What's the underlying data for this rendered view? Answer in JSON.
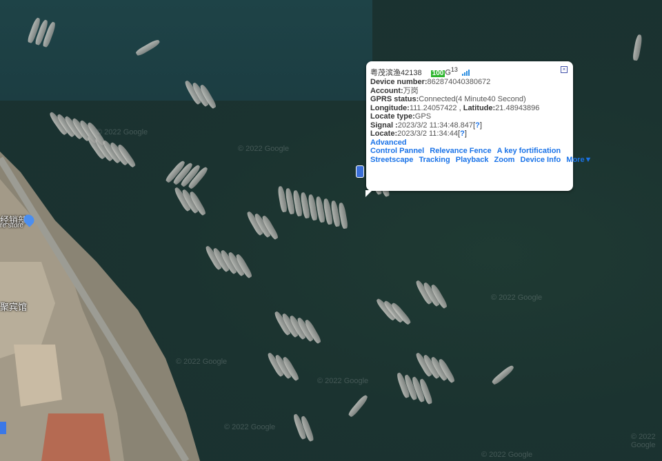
{
  "map": {
    "attribution": "© 2022 Google",
    "labels": {
      "store_cn": "经销部",
      "store_en": "re store",
      "hotel": "聚宾馆"
    }
  },
  "popup": {
    "vehicle_name": "粤茂滨渔42138",
    "battery": "100",
    "network": "G",
    "signal_strength": "13",
    "device_number_label": "Device number:",
    "device_number": "862874040380672",
    "account_label": "Account:",
    "account": "万岗",
    "gprs_label": "GPRS status:",
    "gprs": "Connected(4 Minute40 Second)",
    "longitude_label": "Longitude:",
    "longitude": "111.24057422",
    "latitude_label": "Latitude:",
    "latitude": "21.48943896",
    "locate_type_label": "Locate type:",
    "locate_type": "GPS",
    "signal_label": "Signal :",
    "signal_time": "2023/3/2 11:34:48.847",
    "locate_label": "Locate:",
    "locate_time": "2023/3/2 11:34:44",
    "help": "?",
    "advanced": "Advanced",
    "links_row1": [
      "Control Pannel",
      "Relevance Fence",
      "A key fortification"
    ],
    "links_row2": [
      "Streetscape",
      "Tracking",
      "Playback",
      "Zoom",
      "Device Info",
      "More▼"
    ],
    "close_icon": "close-icon"
  }
}
